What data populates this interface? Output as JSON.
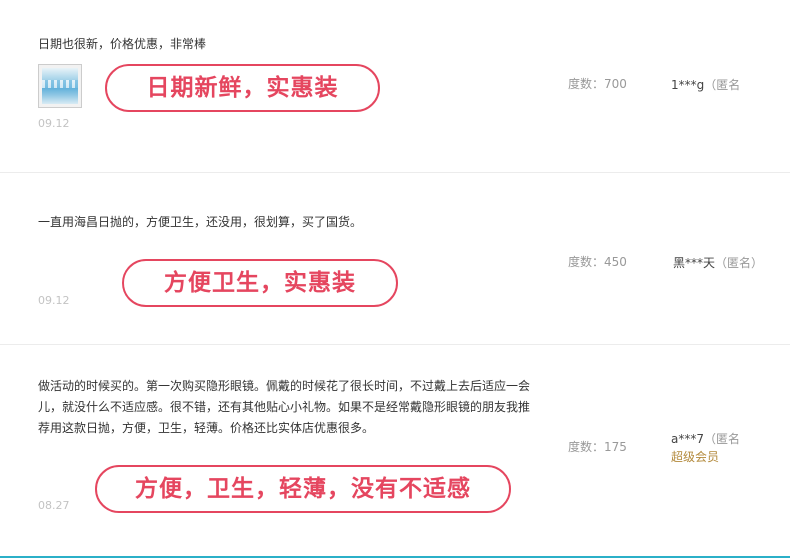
{
  "reviews": [
    {
      "text": "日期也很新，价格优惠，非常棒",
      "date": "09.12",
      "degree": "度数：700",
      "user": "1***g",
      "anon": "（匿名",
      "vip": "",
      "callout": "日期新鲜，实惠装",
      "has_thumbnail": true
    },
    {
      "text": "一直用海昌日抛的，方便卫生，还没用，很划算，买了国货。",
      "date": "09.12",
      "degree": "度数：450",
      "user": "黑***天",
      "anon": "（匿名）",
      "vip": "",
      "callout": "方便卫生，实惠装",
      "has_thumbnail": false
    },
    {
      "text_lines": [
        "做活动的时候买的。第一次购买隐形眼镜。佩戴的时候花了很长时间，不过戴上去后适应一会",
        "儿，就没什么不适应感。很不错，还有其他贴心小礼物。如果不是经常戴隐形眼镜的朋友我推",
        "荐用这款日抛，方便，卫生，轻薄。价格还比实体店优惠很多。"
      ],
      "date": "08.27",
      "degree": "度数：175",
      "user": "a***7",
      "anon": "（匿名",
      "vip": "超级会员",
      "callout": "方便，卫生，轻薄，没有不适感",
      "has_thumbnail": false
    }
  ],
  "colors": {
    "callout": "#e5465f",
    "text": "#333333",
    "muted": "#999999",
    "vip": "#b38a3c",
    "bottom_bar": "#2bb0c8"
  },
  "icons": {
    "thumbnail": "product-thumbnail-image"
  }
}
